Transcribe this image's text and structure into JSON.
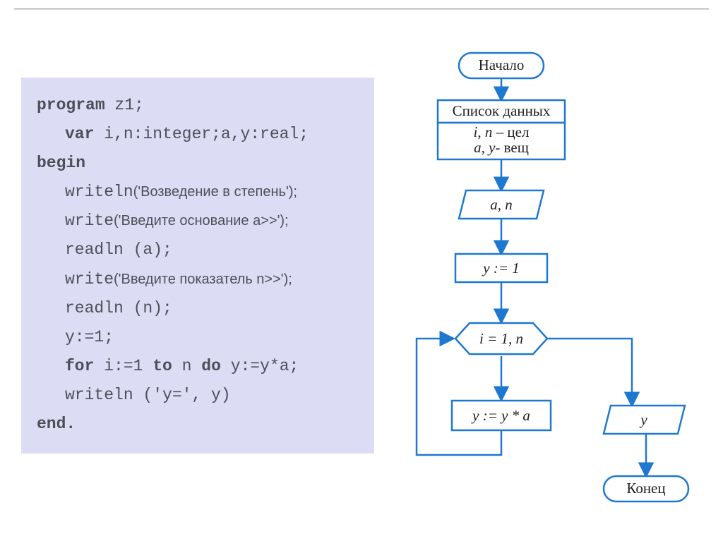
{
  "code": {
    "l1_kw": "program",
    "l1_rest": " z1;",
    "l2_kw": "var",
    "l2_rest": " i,n:integer;a,y:real;",
    "l3_kw": "begin",
    "l4_fn": "writeln",
    "l4_txt": "('Возведение в степень');",
    "l5_fn": "write",
    "l5_txt": "('Введите основание a>>');",
    "l6": "readln (a);",
    "l7_fn": "write",
    "l7_txt": "('Введите показатель n>>');",
    "l8": "readln (n);",
    "l9": "y:=1;",
    "l10_kw1": "for",
    "l10_mid1": " i:=1 ",
    "l10_kw2": "to",
    "l10_mid2": " n ",
    "l10_kw3": "do",
    "l10_rest": " y:=y*a;",
    "l11": "writeln ('y=', y)",
    "l12_kw": "end."
  },
  "flowchart": {
    "start": "Начало",
    "datalist_title": "Список данных",
    "datalist_l1_a": "i, n",
    "datalist_l1_b": " – цел",
    "datalist_l2_a": "a, y",
    "datalist_l2_b": "- вещ",
    "input": "a, n",
    "assign1": "y := 1",
    "loop": "i = 1, n",
    "assign2": "y := y * a",
    "output": "y",
    "end": "Конец"
  }
}
